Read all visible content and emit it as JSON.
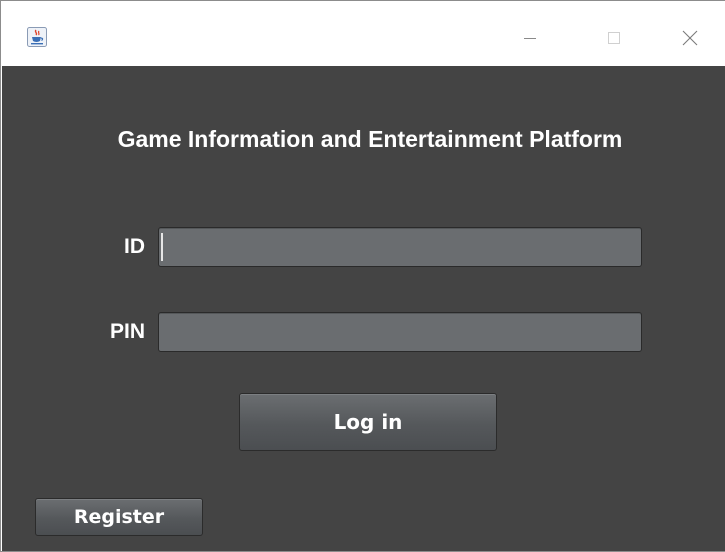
{
  "window": {
    "app_icon": "java-cup-icon",
    "controls": {
      "minimize": "minimize-icon",
      "maximize": "maximize-icon",
      "close": "close-icon"
    }
  },
  "form": {
    "heading": "Game Information and Entertainment Platform",
    "id_label": "ID",
    "id_value": "",
    "pin_label": "PIN",
    "pin_value": "",
    "login_button": "Log in",
    "register_button": "Register"
  },
  "colors": {
    "background": "#444444",
    "field": "#6a6d70",
    "text": "#ffffff"
  }
}
